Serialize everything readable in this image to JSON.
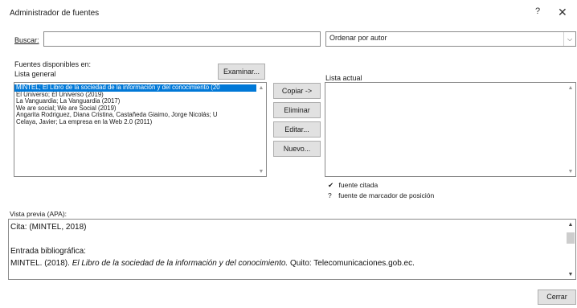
{
  "window": {
    "title": "Administrador de fuentes",
    "help_glyph": "?",
    "close_glyph": "✕"
  },
  "search": {
    "label": "Buscar:",
    "value": "",
    "placeholder": ""
  },
  "sort": {
    "selected": "Ordenar por autor"
  },
  "sources_available": {
    "label": "Fuentes disponibles en:",
    "master_list_label": "Lista general",
    "browse_button": "Examinar..."
  },
  "master_list": {
    "items": [
      "MINTEL; El Libro de la sociedad de la información y del conocimiento (20",
      "El Universo; El Universo (2019)",
      "La Vanguardia; La Vanguardia (2017)",
      "We are social; We are Social (2019)",
      "Angarita Rodriguez, Diana  Cristina, Castañeda Giaimo, Jorge Nicolás; U",
      "Celaya, Javier; La empresa en la Web 2.0 (2011)"
    ],
    "selected_index": 0
  },
  "actions": {
    "copy": "Copiar ->",
    "delete": "Eliminar",
    "edit": "Editar...",
    "new": "Nuevo..."
  },
  "current_list": {
    "label": "Lista actual",
    "items": []
  },
  "legend": {
    "cited_mark": "✔",
    "cited_text": "fuente citada",
    "placeholder_mark": "?",
    "placeholder_text": "fuente de marcador de posición"
  },
  "preview": {
    "label": "Vista previa (APA):",
    "citation": "Cita:  (MINTEL, 2018)",
    "bib_heading": "Entrada bibliográfica:",
    "bib_author_year": "MINTEL. (2018). ",
    "bib_title": "El Libro de la sociedad de la información y del conocimiento.",
    "bib_rest": " Quito: Telecomunicaciones.gob.ec."
  },
  "footer": {
    "close_button": "Cerrar"
  }
}
